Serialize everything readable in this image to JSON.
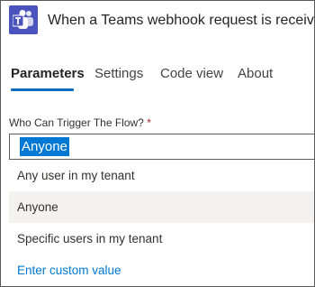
{
  "header": {
    "title": "When a Teams webhook request is received",
    "app_icon": "teams-icon",
    "app_color": "#4b53bc"
  },
  "tabs": [
    {
      "label": "Parameters",
      "active": true
    },
    {
      "label": "Settings",
      "active": false
    },
    {
      "label": "Code view",
      "active": false
    },
    {
      "label": "About",
      "active": false
    }
  ],
  "field": {
    "label": "Who Can Trigger The Flow?",
    "required_mark": "*",
    "value": "Anyone"
  },
  "dropdown": {
    "options": [
      {
        "label": "Any user in my tenant",
        "selected": false
      },
      {
        "label": "Anyone",
        "selected": true
      },
      {
        "label": "Specific users in my tenant",
        "selected": false
      }
    ],
    "custom_label": "Enter custom value"
  },
  "colors": {
    "accent": "#0f6cbd",
    "selection": "#0078d4",
    "required": "#a4262c"
  }
}
